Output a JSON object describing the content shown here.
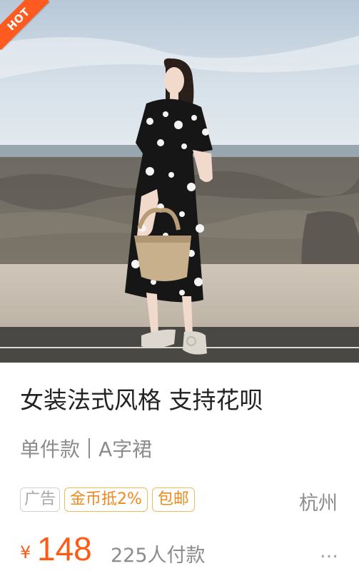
{
  "badge": {
    "text": "HOT",
    "color": "#ff5a1f"
  },
  "product": {
    "title": "女装法式风格 支持花呗",
    "subtitle_part1": "单件款",
    "subtitle_part2": "A字裙",
    "tags": [
      "广告",
      "金币抵2%",
      "包邮"
    ],
    "location": "杭州",
    "currency": "¥",
    "price": "148",
    "sold": "225人付款",
    "more_icon": "…"
  },
  "colors": {
    "accent": "#ff5a14",
    "tag_border": "#f0b95a",
    "tag_text": "#ef8a1a"
  }
}
